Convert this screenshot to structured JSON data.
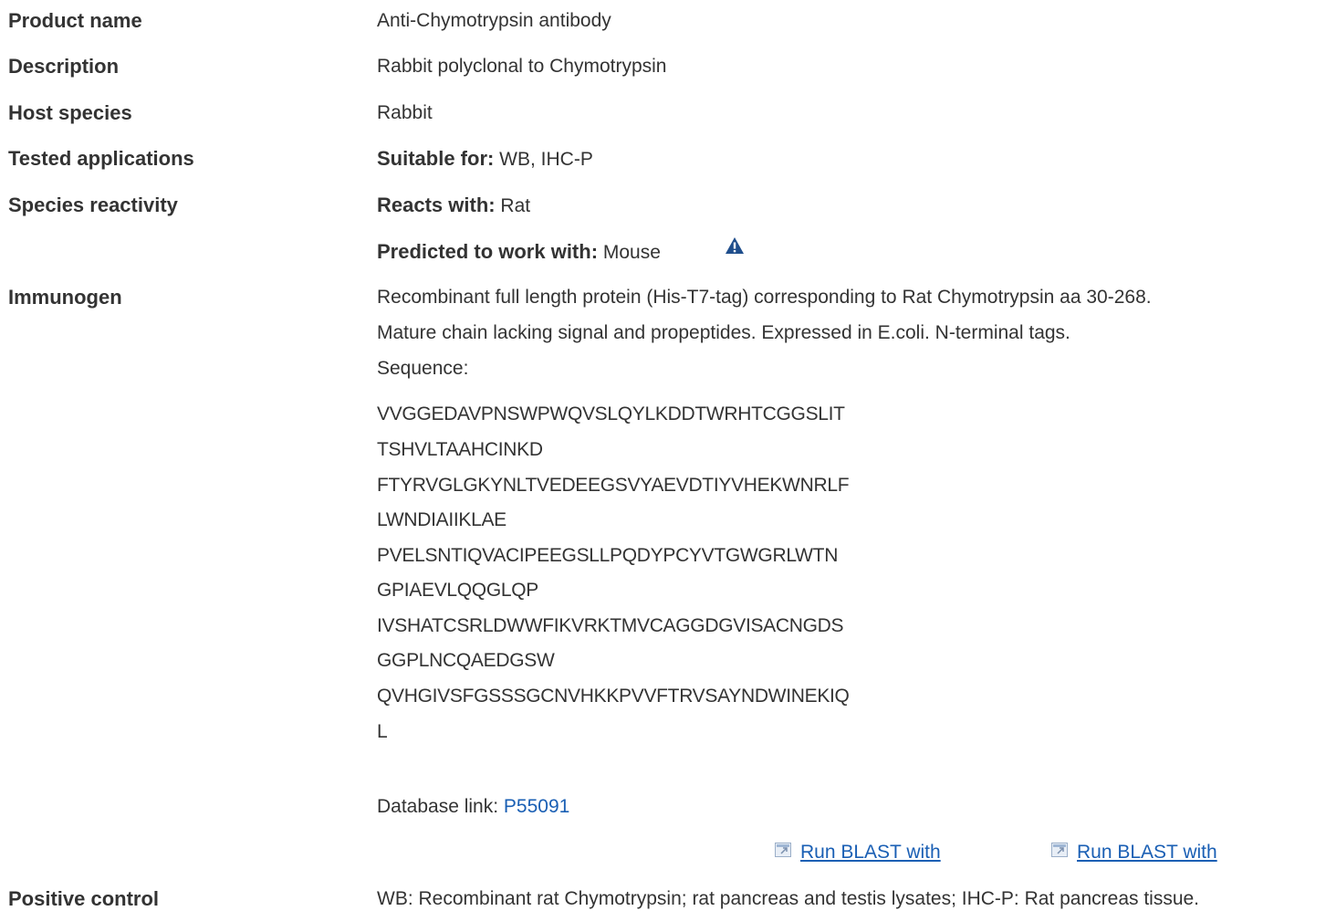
{
  "rows": {
    "product_name": {
      "label": "Product name",
      "value": "Anti-Chymotrypsin antibody"
    },
    "description": {
      "label": "Description",
      "value": "Rabbit polyclonal to Chymotrypsin"
    },
    "host_species": {
      "label": "Host species",
      "value": "Rabbit"
    },
    "tested_applications": {
      "label": "Tested applications",
      "prefix": "Suitable for:",
      "value": " WB, IHC-P"
    },
    "species_reactivity": {
      "label": "Species reactivity",
      "reacts_prefix": "Reacts with:",
      "reacts_value": " Rat",
      "predicted_prefix": "Predicted to work with:",
      "predicted_value": " Mouse",
      "predicted_icon": "warning-triangle-icon"
    },
    "immunogen": {
      "label": "Immunogen",
      "lines": [
        "Recombinant full length protein (His-T7-tag) corresponding to Rat Chymotrypsin aa 30-268.",
        "Mature chain lacking signal and propeptides. Expressed in E.coli. N-terminal tags.",
        "Sequence:"
      ],
      "sequence": [
        "VVGGEDAVPNSWPWQVSLQYLKDDTWRHTCGGSLIT",
        "TSHVLTAAHCINKD",
        "FTYRVGLGKYNLTVEDEEGSVYAEVDTIYVHEKWNRLF",
        "LWNDIAIIKLAE",
        "PVELSNTIQVACIPEEGSLLPQDYPCYVTGWGRLWTN",
        "GPIAEVLQQGLQP",
        "IVSHATCSRLDWWFIKVRKTMVCAGGDGVISACNGDS",
        "GGPLNCQAEDGSW",
        "QVHGIVSFGSSSGCNVHKKPVVFTRVSAYNDWINEKIQ",
        "L"
      ],
      "database_prefix": "Database link: ",
      "database_link": "P55091",
      "blast_1": "Run BLAST with",
      "blast_2": "Run BLAST with",
      "blast_icon": "external-link-icon"
    },
    "positive_control": {
      "label": "Positive control",
      "value": "WB: Recombinant rat Chymotrypsin; rat pancreas and testis lysates; IHC-P: Rat pancreas tissue."
    }
  },
  "colors": {
    "text": "#333333",
    "link": "#1a5fb4",
    "warning_icon": "#1f4e8c"
  }
}
